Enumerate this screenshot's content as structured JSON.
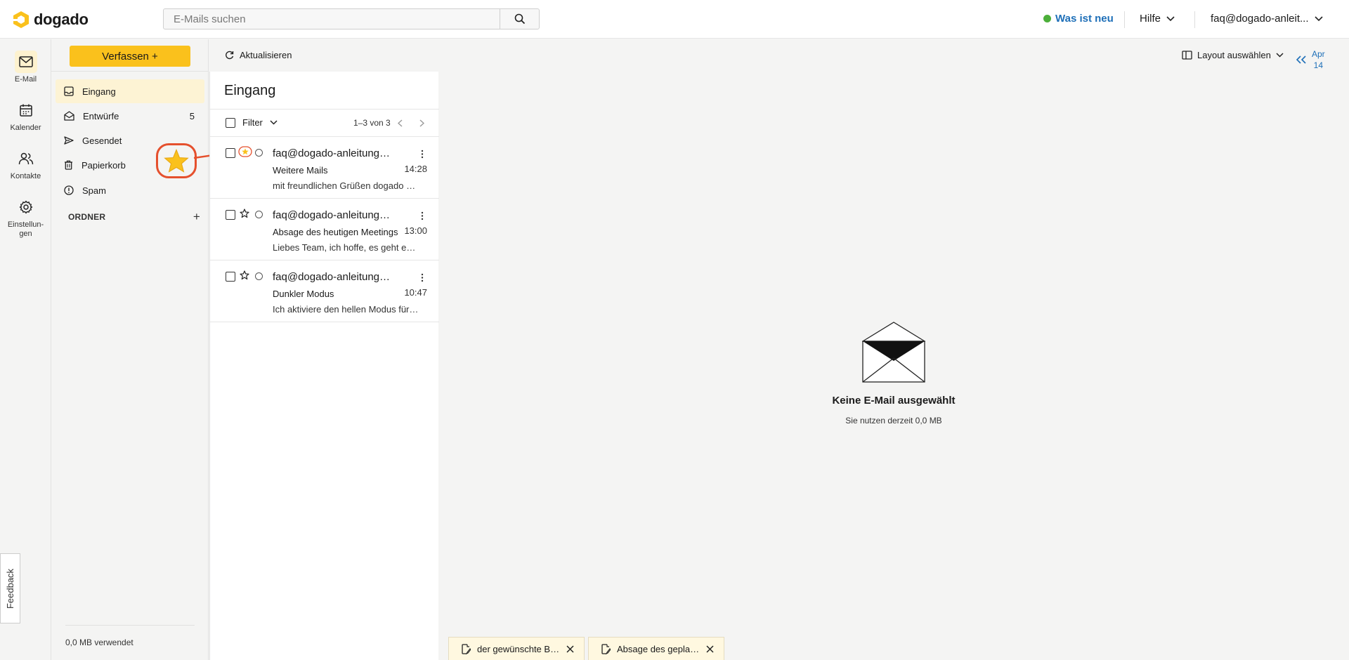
{
  "brand": {
    "name": "dogado"
  },
  "search": {
    "placeholder": "E-Mails suchen"
  },
  "header": {
    "whats_new": "Was ist neu",
    "help": "Hilfe",
    "account": "faq@dogado-anleit..."
  },
  "rail": [
    {
      "label": "E-Mail",
      "icon": "mail-icon"
    },
    {
      "label": "Kalender",
      "icon": "calendar-icon"
    },
    {
      "label": "Kontakte",
      "icon": "contacts-icon"
    },
    {
      "label": "Einstellun-gen",
      "icon": "settings-icon"
    }
  ],
  "feedback": "Feedback",
  "compose": {
    "label": "Verfassen +"
  },
  "folders": [
    {
      "label": "Eingang",
      "count": ""
    },
    {
      "label": "Entwürfe",
      "count": "5"
    },
    {
      "label": "Gesendet",
      "count": ""
    },
    {
      "label": "Papierkorb",
      "count": ""
    },
    {
      "label": "Spam",
      "count": ""
    }
  ],
  "ordner": {
    "label": "ORDNER",
    "add": "+"
  },
  "usage": "0,0 MB verwendet",
  "toolbar": {
    "refresh": "Aktualisieren",
    "layout": "Layout auswählen",
    "date_month": "Apr",
    "date_day": "14"
  },
  "list": {
    "title": "Eingang",
    "filter": "Filter",
    "pager": "1–3 von 3",
    "mails": [
      {
        "from": "faq@dogado-anleitungen.de",
        "subject": "Weitere Mails",
        "time": "14:28",
        "preview": "mit freundlichen Grüßen dogado Support",
        "starred": true
      },
      {
        "from": "faq@dogado-anleitungen.de",
        "subject": "Absage des heutigen Meetings",
        "time": "13:00",
        "preview": "Liebes Team, ich hoffe, es geht euch gut",
        "starred": false
      },
      {
        "from": "faq@dogado-anleitungen.de",
        "subject": "Dunkler Modus",
        "time": "10:47",
        "preview": "Ich aktiviere den hellen Modus für dich",
        "starred": false
      }
    ]
  },
  "empty": {
    "title": "Keine E-Mail ausgewählt",
    "subtitle": "Sie nutzen derzeit 0,0 MB"
  },
  "drafts": [
    {
      "label": "der gewünschte Bericht"
    },
    {
      "label": "Absage des geplanten Meetings"
    }
  ],
  "colors": {
    "accent": "#fac11c",
    "link": "#1e6fb8",
    "annotation": "#e5502d",
    "online": "#4caf3a"
  }
}
